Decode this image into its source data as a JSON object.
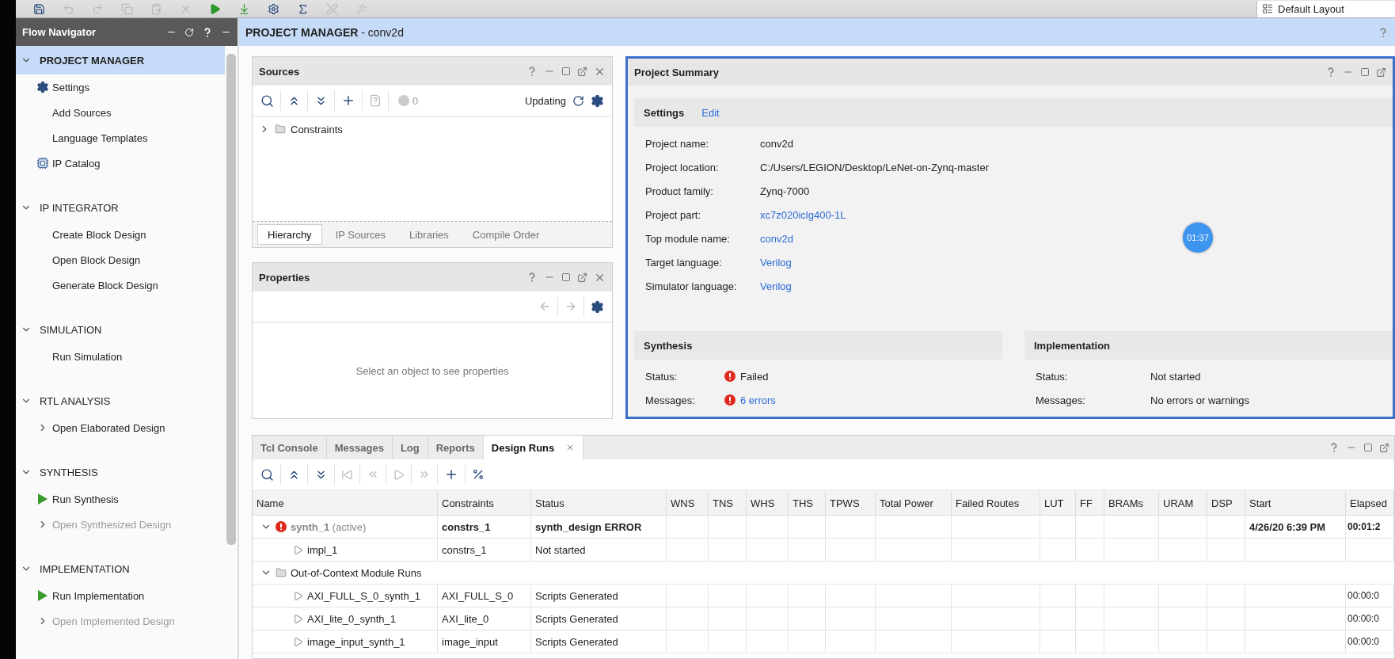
{
  "toolbar": {
    "layout_label": "Default Layout"
  },
  "flow_navigator": {
    "title": "Flow Navigator",
    "sections": [
      {
        "title": "PROJECT MANAGER",
        "selected": true,
        "expanded": true,
        "items": [
          {
            "label": "Settings",
            "kind": "gear",
            "disabled": false
          },
          {
            "label": "Add Sources",
            "kind": "plain",
            "disabled": false
          },
          {
            "label": "Language Templates",
            "kind": "plain",
            "disabled": false
          },
          {
            "label": "IP Catalog",
            "kind": "chip",
            "disabled": false
          }
        ]
      },
      {
        "title": "IP INTEGRATOR",
        "selected": false,
        "expanded": true,
        "items": [
          {
            "label": "Create Block Design",
            "kind": "plain",
            "disabled": false
          },
          {
            "label": "Open Block Design",
            "kind": "plain",
            "disabled": false
          },
          {
            "label": "Generate Block Design",
            "kind": "plain",
            "disabled": false
          }
        ]
      },
      {
        "title": "SIMULATION",
        "selected": false,
        "expanded": true,
        "items": [
          {
            "label": "Run Simulation",
            "kind": "plain",
            "disabled": false
          }
        ]
      },
      {
        "title": "RTL ANALYSIS",
        "selected": false,
        "expanded": true,
        "items": [
          {
            "label": "Open Elaborated Design",
            "kind": "expandable",
            "disabled": false
          }
        ]
      },
      {
        "title": "SYNTHESIS",
        "selected": false,
        "expanded": true,
        "items": [
          {
            "label": "Run Synthesis",
            "kind": "run",
            "disabled": false
          },
          {
            "label": "Open Synthesized Design",
            "kind": "expandable",
            "disabled": true
          }
        ]
      },
      {
        "title": "IMPLEMENTATION",
        "selected": false,
        "expanded": true,
        "items": [
          {
            "label": "Run Implementation",
            "kind": "run",
            "disabled": false
          },
          {
            "label": "Open Implemented Design",
            "kind": "expandable",
            "disabled": true
          }
        ]
      }
    ]
  },
  "header": {
    "title": "**PROJECT MANAGER** - conv2d"
  },
  "sources": {
    "title": "Sources",
    "count": "0",
    "status": "Updating",
    "tree": [
      {
        "label": "Constraints",
        "expanded": false
      }
    ],
    "tabs": [
      {
        "label": "Hierarchy",
        "selected": true
      },
      {
        "label": "IP Sources",
        "selected": false
      },
      {
        "label": "Libraries",
        "selected": false
      },
      {
        "label": "Compile Order",
        "selected": false
      }
    ]
  },
  "properties": {
    "title": "Properties",
    "empty_message": "Select an object to see properties"
  },
  "summary": {
    "title": "Project Summary",
    "timer": "01:37",
    "settings": {
      "title": "Settings",
      "action": "Edit",
      "rows": [
        {
          "label": "Project name:",
          "value": "conv2d",
          "link": false
        },
        {
          "label": "Project location:",
          "value": "C:/Users/LEGION/Desktop/LeNet-on-Zynq-master",
          "link": false
        },
        {
          "label": "Product family:",
          "value": "Zynq-7000",
          "link": false
        },
        {
          "label": "Project part:",
          "value": "xc7z020iclg400-1L",
          "link": true
        },
        {
          "label": "Top module name:",
          "value": "conv2d",
          "link": true
        },
        {
          "label": "Target language:",
          "value": "Verilog",
          "link": true
        },
        {
          "label": "Simulator language:",
          "value": "Verilog",
          "link": true
        }
      ]
    },
    "groups": [
      {
        "title": "Synthesis",
        "rows": [
          {
            "label": "Status:",
            "value": "Failed",
            "error": true,
            "link": false
          },
          {
            "label": "Messages:",
            "value": "6 errors",
            "error": true,
            "link": true
          }
        ]
      },
      {
        "title": "Implementation",
        "rows": [
          {
            "label": "Status:",
            "value": "Not started",
            "error": false,
            "link": false
          },
          {
            "label": "Messages:",
            "value": "No errors or warnings",
            "error": false,
            "link": false
          }
        ]
      }
    ]
  },
  "console": {
    "tabs": [
      {
        "label": "Tcl Console",
        "selected": false
      },
      {
        "label": "Messages",
        "selected": false
      },
      {
        "label": "Log",
        "selected": false
      },
      {
        "label": "Reports",
        "selected": false
      },
      {
        "label": "Design Runs",
        "selected": true
      }
    ],
    "columns": [
      "Name",
      "Constraints",
      "Status",
      "WNS",
      "TNS",
      "WHS",
      "THS",
      "TPWS",
      "Total Power",
      "Failed Routes",
      "LUT",
      "FF",
      "BRAMs",
      "URAM",
      "DSP",
      "Start",
      "Elapsed"
    ],
    "rows": [
      {
        "kind": "run",
        "name": "**synth_1** (active)",
        "active": true,
        "error": true,
        "expanded": true,
        "constraints": "constrs_1",
        "status": "synth_design ERROR",
        "start": "4/26/20 6:39 PM",
        "elapsed": "00:01:2",
        "children": [
          {
            "kind": "run",
            "name": "impl_1",
            "active": false,
            "error": false,
            "constraints": "constrs_1",
            "status": "Not started"
          }
        ]
      },
      {
        "kind": "group",
        "name": "Out-of-Context Module Runs",
        "expanded": true,
        "children": [
          {
            "kind": "run",
            "name": "AXI_FULL_S_0_synth_1",
            "active": false,
            "error": false,
            "constraints": "AXI_FULL_S_0",
            "status": "Scripts Generated",
            "elapsed": "00:00:0"
          },
          {
            "kind": "run",
            "name": "AXI_lite_0_synth_1",
            "active": false,
            "error": false,
            "constraints": "AXI_lite_0",
            "status": "Scripts Generated",
            "elapsed": "00:00:0"
          },
          {
            "kind": "run",
            "name": "image_input_synth_1",
            "active": false,
            "error": false,
            "constraints": "image_input",
            "status": "Scripts Generated",
            "elapsed": "00:00:0"
          }
        ]
      }
    ]
  }
}
